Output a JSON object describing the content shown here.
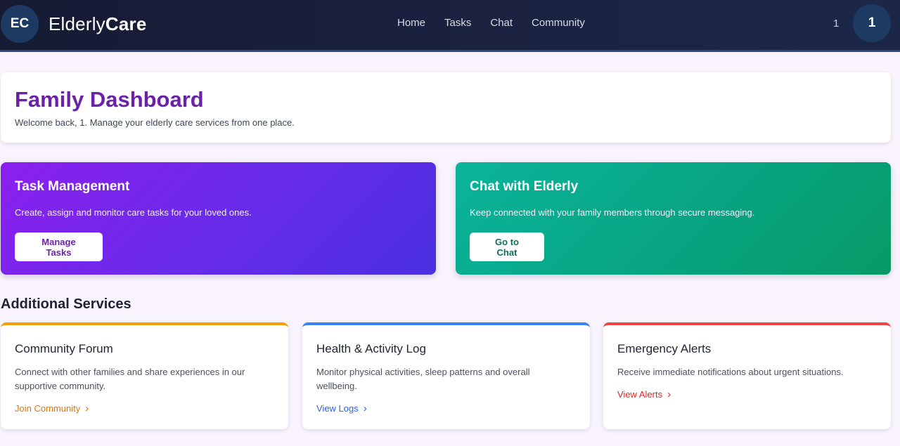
{
  "navbar": {
    "logo_badge": "EC",
    "logo_light": "Elderly",
    "logo_bold": "Care",
    "links": [
      "Home",
      "Tasks",
      "Chat",
      "Community"
    ],
    "notification_count": "1",
    "avatar_initial": "1"
  },
  "header": {
    "title": "Family Dashboard",
    "subtitle": "Welcome back, 1. Manage your elderly care services from one place."
  },
  "features": {
    "tasks": {
      "title": "Task Management",
      "description": "Create, assign and monitor care tasks for your loved ones.",
      "button": "Manage Tasks"
    },
    "chat": {
      "title": "Chat with Elderly",
      "description": "Keep connected with your family members through secure messaging.",
      "button": "Go to Chat"
    }
  },
  "services": {
    "section_title": "Additional Services",
    "items": [
      {
        "title": "Community Forum",
        "description": "Connect with other families and share experiences in our supportive community.",
        "link": "Join Community",
        "accent": "#f59e0b"
      },
      {
        "title": "Health & Activity Log",
        "description": "Monitor physical activities, sleep patterns and overall wellbeing.",
        "link": "View Logs",
        "accent": "#3b82f6"
      },
      {
        "title": "Emergency Alerts",
        "description": "Receive immediate notifications about urgent situations.",
        "link": "View Alerts",
        "accent": "#ef4444"
      }
    ]
  },
  "colors": {
    "brand_purple": "#6b21a8",
    "nav_bg": "#161b33",
    "page_bg": "#f8f3fc",
    "chat_green": "#07a482"
  }
}
